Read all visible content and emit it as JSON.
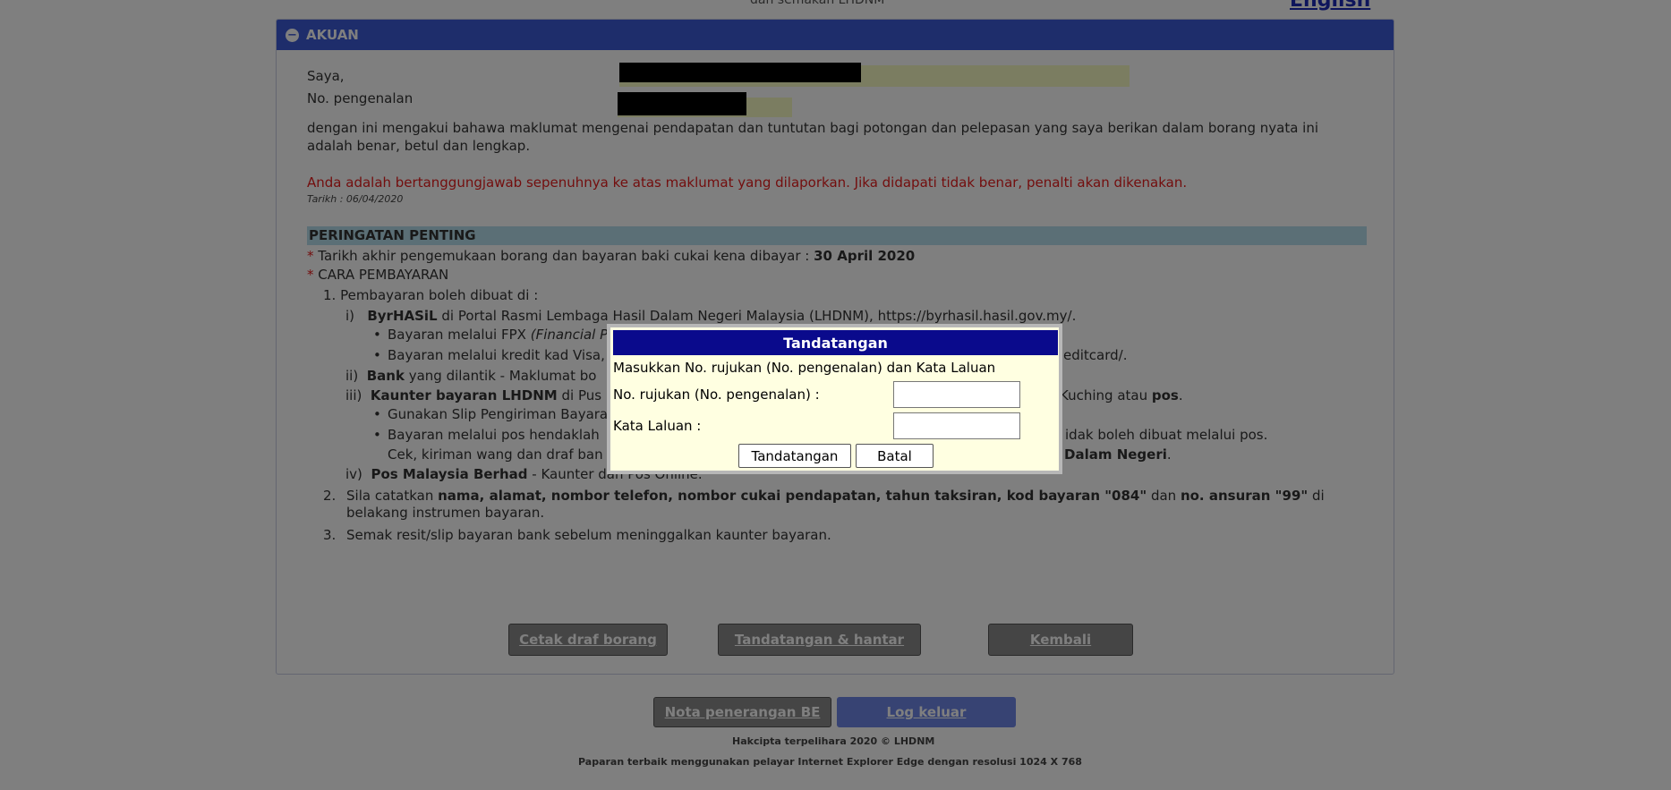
{
  "header": {
    "subtitle": "dan semakan LHDNM",
    "language_link": "English"
  },
  "panel": {
    "title": "AKUAN",
    "saya_label": "Saya,",
    "id_label": "No. pengenalan",
    "declaration": "dengan ini mengakui bahawa maklumat mengenai pendapatan dan tuntutan bagi potongan dan pelepasan yang saya berikan dalam borang nyata ini adalah benar, betul dan lengkap.",
    "warning": "Anda adalah bertanggungjawab sepenuhnya ke atas maklumat yang dilaporkan. Jika didapati tidak benar, penalti akan dikenakan.",
    "date_text": "Tarikh : 06/04/2020"
  },
  "notice": {
    "title": "PERINGATAN PENTING",
    "deadline_text": "Tarikh akhir pengemukaan borang dan bayaran baki cukai kena dibayar : ",
    "deadline_date": "30 April 2020",
    "payment_method_title": "CARA PEMBAYARAN",
    "item1": "1.  Pembayaran boleh dibuat di :",
    "i_label": "i)",
    "i_bold": "ByrHASiL",
    "i_text": " di Portal Rasmi Lembaga Hasil Dalam Negeri Malaysia (LHDNM), https://byrhasil.hasil.gov.my/.",
    "i_bullet1_text": "Bayaran melalui FPX ",
    "i_bullet1_italic": "(Financial P",
    "i_bullet2_text": "Bayaran melalui kredit kad Visa,",
    "i_bullet2_tail": "editcard/.",
    "ii_label": "ii)",
    "ii_bold": "Bank",
    "ii_text": " yang dilantik - Maklumat bo",
    "iii_label": "iii)",
    "iii_bold": "Kaunter bayaran LHDNM",
    "iii_text": " di Pus",
    "iii_tail_text": "Kuching atau ",
    "iii_tail_bold": "pos",
    "iii_tail_end": ".",
    "iii_bullet1": "Gunakan Slip Pengiriman Bayara",
    "iii_bullet2": "Bayaran melalui pos hendaklah",
    "iii_bullet2_tail": "idak boleh dibuat melalui pos.",
    "iii_cek": "Cek, kiriman wang dan draf ban",
    "iii_cek_tail_bold": "Dalam Negeri",
    "iii_cek_tail_end": ".",
    "iv_label": "iv)",
    "iv_bold": "Pos Malaysia Berhad",
    "iv_text": " - Kaunter dan Pos Online.",
    "item2_prefix": "Sila catatkan ",
    "item2_bold1": "nama, alamat, nombor telefon, nombor cukai pendapatan, tahun taksiran, kod bayaran \"084\"",
    "item2_mid": " dan ",
    "item2_bold2": "no. ansuran \"99\"",
    "item2_tail": " di",
    "item2_line2": "belakang instrumen bayaran.",
    "item2_num": "2.",
    "item3_num": "3.",
    "item3": "Semak resit/slip bayaran bank sebelum meninggalkan kaunter bayaran."
  },
  "actions": {
    "print_draft": "Cetak draf borang",
    "sign_submit": "Tandatangan & hantar",
    "back": "Kembali"
  },
  "footer": {
    "guide": "Nota penerangan BE",
    "logout": "Log keluar",
    "copyright": "Hakcipta terpelihara 2020 © LHDNM",
    "browser_note": "Paparan terbaik menggunakan pelayar Internet Explorer Edge dengan resolusi 1024 X 768"
  },
  "dialog": {
    "title": "Tandatangan",
    "instruction": "Masukkan No. rujukan (No. pengenalan) dan Kata Laluan",
    "ref_label": "No. rujukan (No. pengenalan) :",
    "ref_value": "",
    "password_label": "Kata Laluan :",
    "password_value": "",
    "sign_button": "Tandatangan",
    "cancel_button": "Batal"
  }
}
